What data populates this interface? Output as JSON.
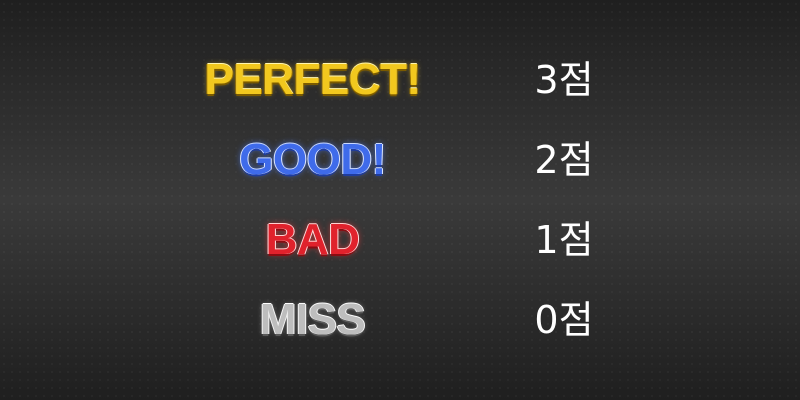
{
  "score_table": {
    "rows": [
      {
        "judgement": "PERFECT!",
        "points": "3점",
        "color": "#f2c81e"
      },
      {
        "judgement": "GOOD!",
        "points": "2점",
        "color": "#3f6bea"
      },
      {
        "judgement": "BAD",
        "points": "1점",
        "color": "#e0222c"
      },
      {
        "judgement": "MISS",
        "points": "0점",
        "color": "#bdbdbd"
      }
    ]
  }
}
